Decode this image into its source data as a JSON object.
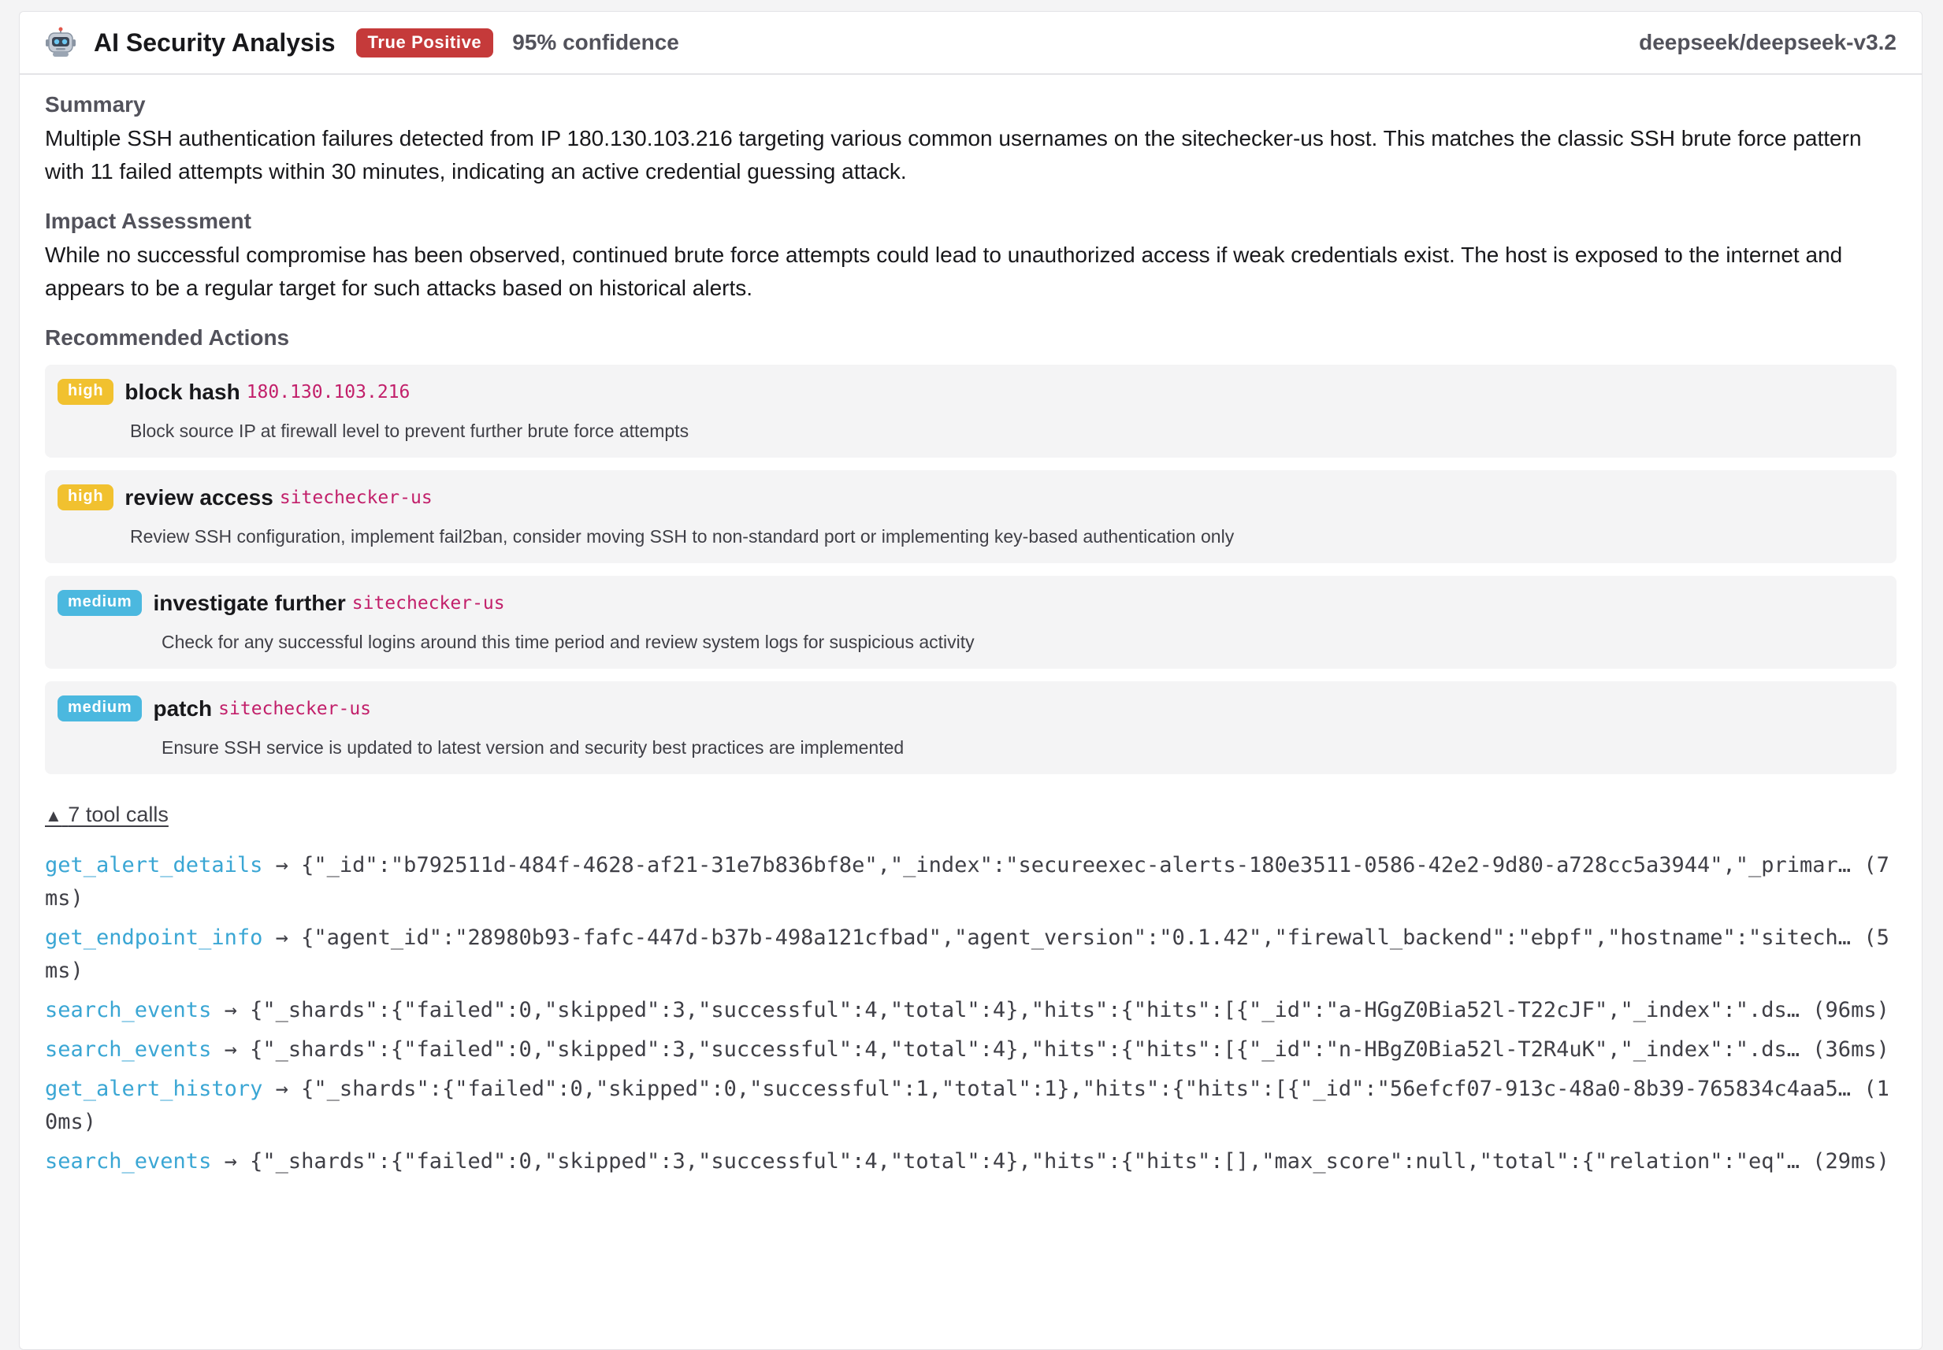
{
  "header": {
    "title": "AI Security Analysis",
    "verdict": "True Positive",
    "confidence": "95% confidence",
    "model": "deepseek/deepseek-v3.2"
  },
  "summary": {
    "title": "Summary",
    "text": "Multiple SSH authentication failures detected from IP 180.130.103.216 targeting various common usernames on the sitechecker-us host. This matches the classic SSH brute force pattern with 11 failed attempts within 30 minutes, indicating an active credential guessing attack."
  },
  "impact": {
    "title": "Impact Assessment",
    "text": "While no successful compromise has been observed, continued brute force attempts could lead to unauthorized access if weak credentials exist. The host is exposed to the internet and appears to be a regular target for such attacks based on historical alerts."
  },
  "actions": {
    "title": "Recommended Actions",
    "items": [
      {
        "priority": "high",
        "name": "block hash",
        "target": "180.130.103.216",
        "description": "Block source IP at firewall level to prevent further brute force attempts"
      },
      {
        "priority": "high",
        "name": "review access",
        "target": "sitechecker-us",
        "description": "Review SSH configuration, implement fail2ban, consider moving SSH to non-standard port or implementing key-based authentication only"
      },
      {
        "priority": "medium",
        "name": "investigate further",
        "target": "sitechecker-us",
        "description": "Check for any successful logins around this time period and review system logs for suspicious activity"
      },
      {
        "priority": "medium",
        "name": "patch",
        "target": "sitechecker-us",
        "description": "Ensure SSH service is updated to latest version and security best practices are implemented"
      }
    ]
  },
  "tool_calls": {
    "toggle_arrow": "▲",
    "toggle_label": "7 tool calls",
    "arrow": "→",
    "items": [
      {
        "name": "get_alert_details",
        "result": "{\"_id\":\"b792511d-484f-4628-af21-31e7b836bf8e\",\"_index\":\"secureexec-alerts-180e3511-0586-42e2-9d80-a728cc5a3944\",\"_primar…",
        "duration": "(7ms)"
      },
      {
        "name": "get_endpoint_info",
        "result": "{\"agent_id\":\"28980b93-fafc-447d-b37b-498a121cfbad\",\"agent_version\":\"0.1.42\",\"firewall_backend\":\"ebpf\",\"hostname\":\"sitech…",
        "duration": "(5ms)"
      },
      {
        "name": "search_events",
        "result": "{\"_shards\":{\"failed\":0,\"skipped\":3,\"successful\":4,\"total\":4},\"hits\":{\"hits\":[{\"_id\":\"a-HGgZ0Bia52l-T22cJF\",\"_index\":\".ds…",
        "duration": "(96ms)"
      },
      {
        "name": "search_events",
        "result": "{\"_shards\":{\"failed\":0,\"skipped\":3,\"successful\":4,\"total\":4},\"hits\":{\"hits\":[{\"_id\":\"n-HBgZ0Bia52l-T2R4uK\",\"_index\":\".ds…",
        "duration": "(36ms)"
      },
      {
        "name": "get_alert_history",
        "result": "{\"_shards\":{\"failed\":0,\"skipped\":0,\"successful\":1,\"total\":1},\"hits\":{\"hits\":[{\"_id\":\"56efcf07-913c-48a0-8b39-765834c4aa5…",
        "duration": "(10ms)"
      },
      {
        "name": "search_events",
        "result": "{\"_shards\":{\"failed\":0,\"skipped\":3,\"successful\":4,\"total\":4},\"hits\":{\"hits\":[],\"max_score\":null,\"total\":{\"relation\":\"eq\"…",
        "duration": "(29ms)"
      }
    ]
  },
  "colors": {
    "verdict": "#c53a3a",
    "high": "#f1c12f",
    "medium": "#4bb8df",
    "target": "#c21f6a",
    "tool_name": "#3aa6d4"
  },
  "icons": {
    "header": "robot-icon",
    "toggle": "triangle-up-icon"
  }
}
